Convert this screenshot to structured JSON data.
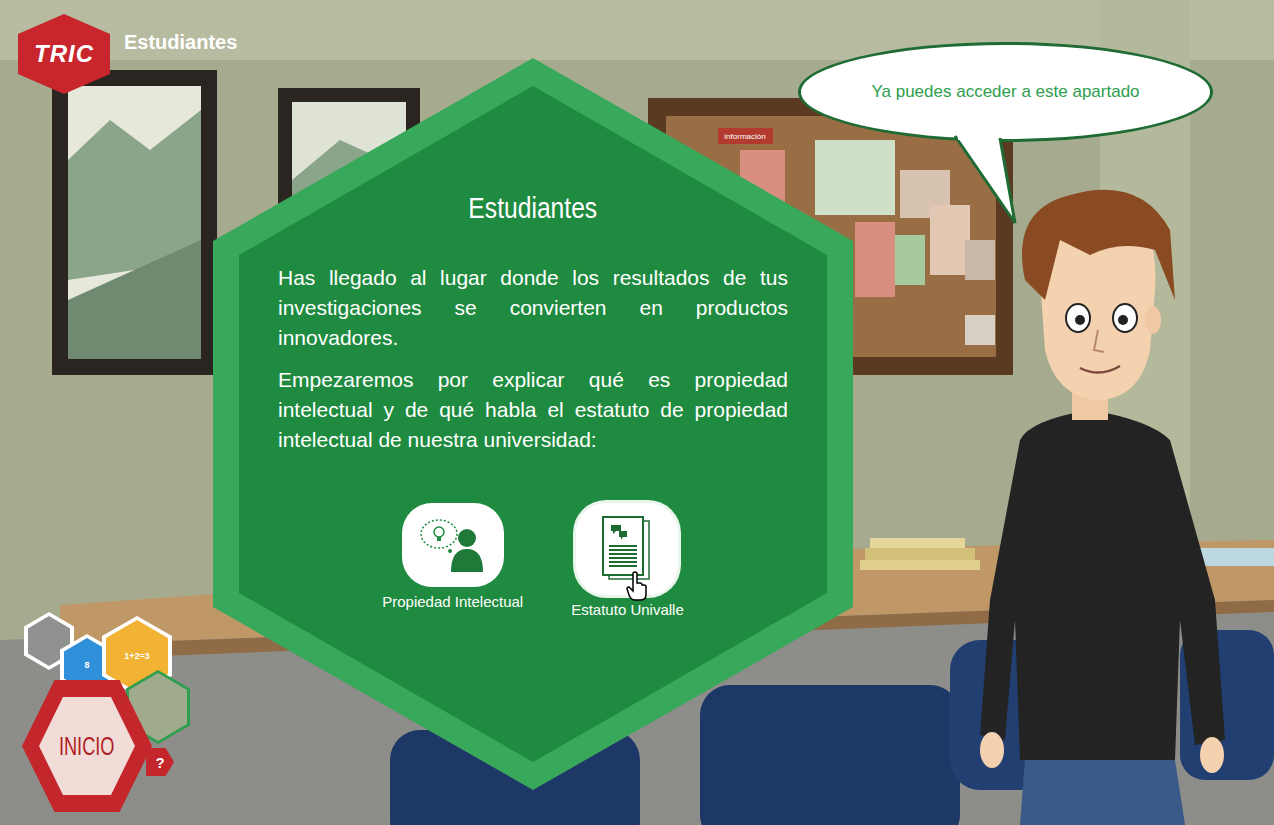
{
  "header": {
    "logo": "TRIC",
    "title": "Estudiantes"
  },
  "scene": {
    "board_label": "información"
  },
  "panel": {
    "title": "Estudiantes",
    "paragraphs": [
      "Has llegado al lugar donde los resultados de tus investigaciones se convierten en productos innovadores.",
      "Empezaremos por explicar qué es propiedad intelectual  y de qué habla el estatuto de propiedad intelectual de nuestra universidad:"
    ],
    "options": [
      {
        "label": "Propiedad Intelectual",
        "kind": "person",
        "selected": false
      },
      {
        "label": "Estatuto Univalle",
        "kind": "document",
        "selected": true
      }
    ]
  },
  "bubble": {
    "text": "Ya puedes acceder a este apartado"
  },
  "nav": {
    "home": "INICIO",
    "help": "?",
    "items": [
      {
        "kind": "filled",
        "color": "#8f9090",
        "label": ""
      },
      {
        "kind": "filled",
        "color": "#2f8fd8",
        "label": "8"
      },
      {
        "kind": "filled",
        "color": "#f2b233",
        "label": "1+2=3"
      },
      {
        "kind": "outline",
        "color": "#2e9e4f",
        "label": ""
      }
    ]
  }
}
